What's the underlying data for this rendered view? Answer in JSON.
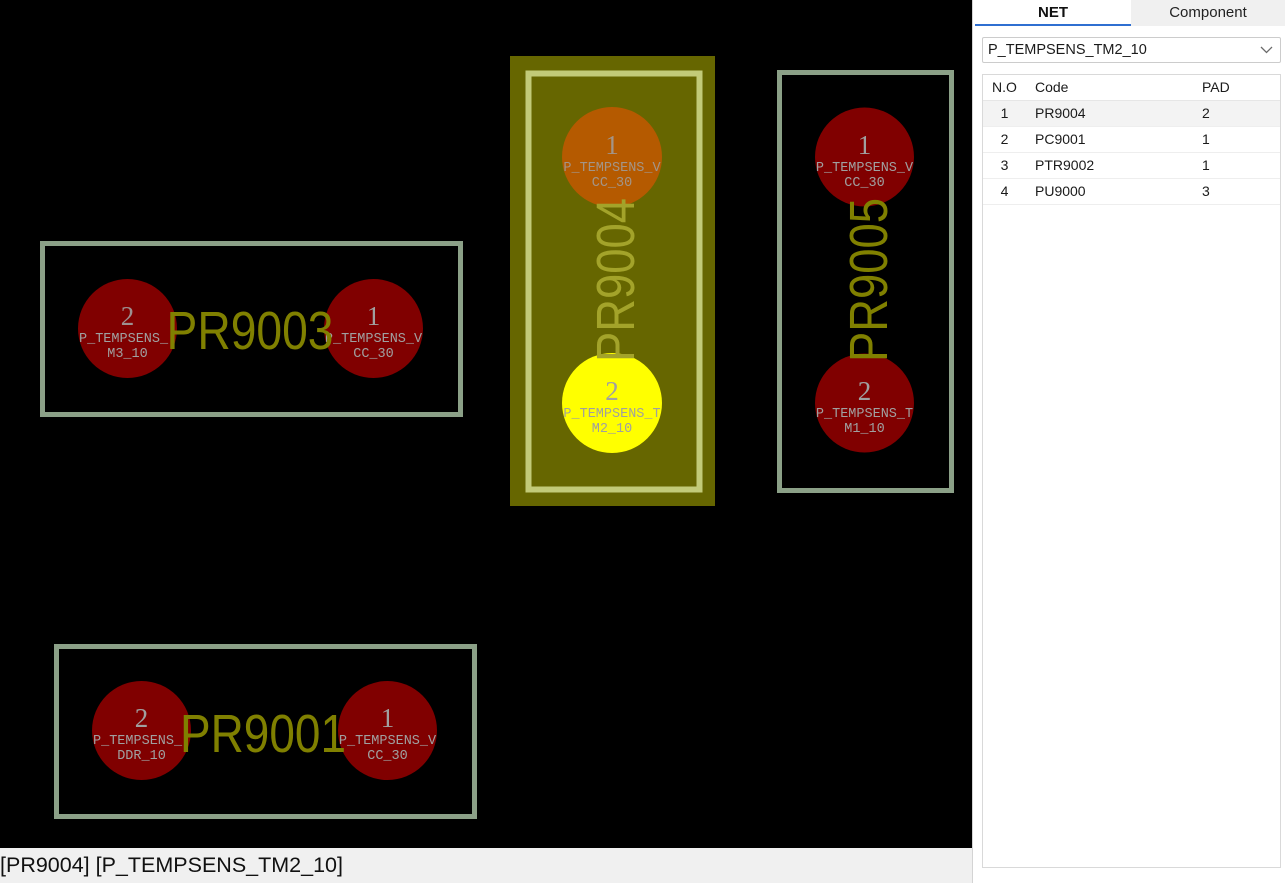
{
  "colors": {
    "board_background": "#000000",
    "component_outline": "#8ba087",
    "pad": "#800000",
    "pad_selected": "#b55a00",
    "pad_highlighted": "#ffff00",
    "selected_component_fill": "#666600",
    "selected_component_outline": "#c2ca78",
    "component_label": "#808000",
    "selected_component_label": "#a3a32a",
    "pad_text": "#a0a0a0",
    "tab_accent": "#2f6fd1"
  },
  "canvas": {
    "components": [
      {
        "ref": "PR9003",
        "selected": false,
        "pads": [
          {
            "number": "2",
            "net_lines": [
              "P_TEMPSENS_",
              "M3_10"
            ]
          },
          {
            "number": "1",
            "net_lines": [
              "P_TEMPSENS_V",
              "CC_30"
            ]
          }
        ]
      },
      {
        "ref": "PR9004",
        "selected": true,
        "pads": [
          {
            "number": "1",
            "net_lines": [
              "P_TEMPSENS_V",
              "CC_30"
            ]
          },
          {
            "number": "2",
            "net_lines": [
              "P_TEMPSENS_T",
              "M2_10"
            ],
            "highlighted": true
          }
        ]
      },
      {
        "ref": "PR9005",
        "selected": false,
        "pads": [
          {
            "number": "1",
            "net_lines": [
              "P_TEMPSENS_V",
              "CC_30"
            ]
          },
          {
            "number": "2",
            "net_lines": [
              "P_TEMPSENS_T",
              "M1_10"
            ]
          }
        ]
      },
      {
        "ref": "PR9001",
        "selected": false,
        "pads": [
          {
            "number": "2",
            "net_lines": [
              "P_TEMPSENS_",
              "DDR_10"
            ]
          },
          {
            "number": "1",
            "net_lines": [
              "P_TEMPSENS_V",
              "CC_30"
            ]
          }
        ]
      }
    ]
  },
  "panel": {
    "tabs": [
      {
        "label": "NET",
        "selected": true
      },
      {
        "label": "Component",
        "selected": false
      }
    ],
    "net_select": {
      "value": "P_TEMPSENS_TM2_10",
      "icon": "chevron-down-icon"
    },
    "table": {
      "columns": [
        "N.O",
        "Code",
        "PAD"
      ],
      "rows": [
        {
          "no": "1",
          "code": "PR9004",
          "pad": "2"
        },
        {
          "no": "2",
          "code": "PC9001",
          "pad": "1"
        },
        {
          "no": "3",
          "code": "PTR9002",
          "pad": "1"
        },
        {
          "no": "4",
          "code": "PU9000",
          "pad": "3"
        }
      ]
    }
  },
  "status_bar": {
    "text": "[PR9004] [P_TEMPSENS_TM2_10]"
  }
}
